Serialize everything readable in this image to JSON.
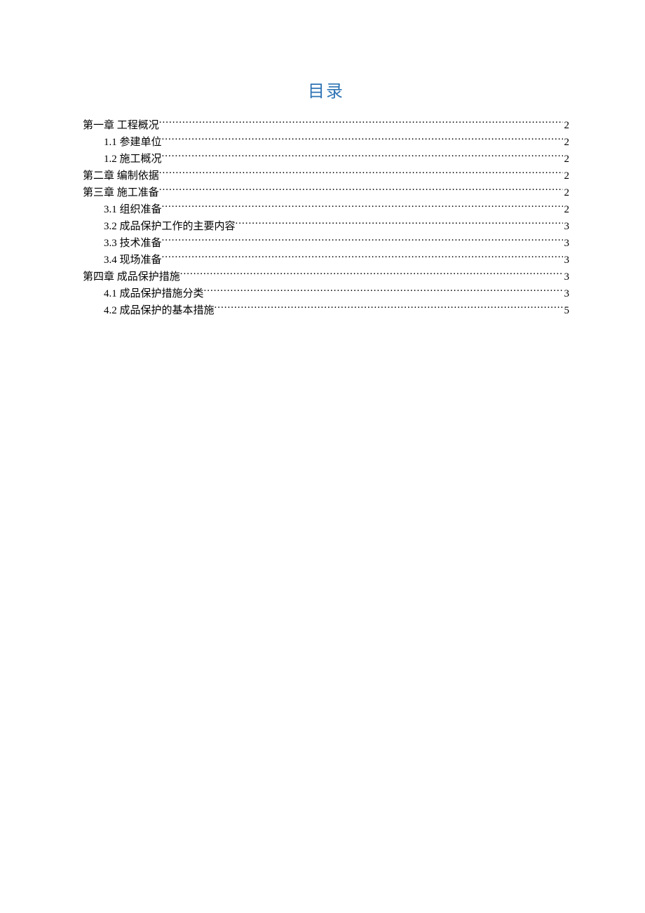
{
  "title": "目录",
  "entries": [
    {
      "level": 0,
      "label": "第一章  工程概况",
      "page": "2"
    },
    {
      "level": 1,
      "label": "1.1 参建单位",
      "page": "2"
    },
    {
      "level": 1,
      "label": "1.2 施工概况",
      "page": "2"
    },
    {
      "level": 0,
      "label": "第二章  编制依据",
      "page": "2"
    },
    {
      "level": 0,
      "label": "第三章  施工准备",
      "page": "2"
    },
    {
      "level": 1,
      "label": "3.1 组织准备",
      "page": "2"
    },
    {
      "level": 1,
      "label": "3.2 成品保护工作的主要内容",
      "page": "3"
    },
    {
      "level": 1,
      "label": "3.3 技术准备",
      "page": "3"
    },
    {
      "level": 1,
      "label": "3.4 现场准备",
      "page": "3"
    },
    {
      "level": 0,
      "label": "第四章  成品保护措施",
      "page": "3"
    },
    {
      "level": 1,
      "label": "4.1 成品保护措施分类",
      "page": "3"
    },
    {
      "level": 1,
      "label": "4.2 成品保护的基本措施",
      "page": "5"
    }
  ]
}
